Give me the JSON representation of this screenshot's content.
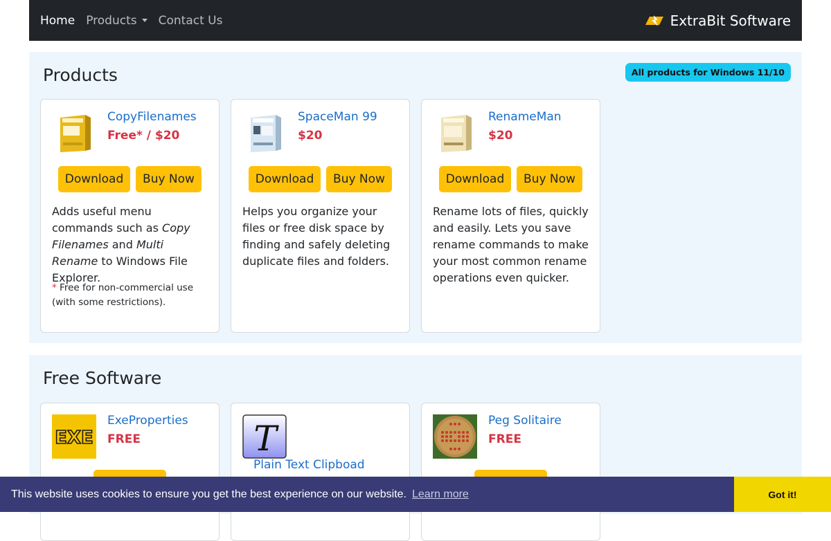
{
  "nav": {
    "home": "Home",
    "products": "Products",
    "contact": "Contact Us",
    "brand": "ExtraBit Software"
  },
  "products_section": {
    "title": "Products",
    "badge": "All products for Windows 11/10",
    "download_label": "Download",
    "buy_label": "Buy Now",
    "items": [
      {
        "name": "CopyFilenames",
        "price": "Free* / $20",
        "desc_1": "Adds useful menu commands such as ",
        "desc_em1": "Copy Filenames",
        "desc_2": " and ",
        "desc_em2": "Multi Rename",
        "desc_3": " to Windows File Explorer.",
        "footnote_star": "*",
        "footnote": " Free for non-commercial use (with some restrictions)."
      },
      {
        "name": "SpaceMan 99",
        "price": "$20",
        "desc": "Helps you organize your files or free disk space by finding and safely deleting duplicate files and folders."
      },
      {
        "name": "RenameMan",
        "price": "$20",
        "desc": "Rename lots of files, quickly and easily. Lets you save rename commands to make your most common rename operations even quicker."
      }
    ]
  },
  "free_section": {
    "title": "Free Software",
    "items": [
      {
        "name": "ExeProperties",
        "price": "FREE",
        "icon_text": "EXE"
      },
      {
        "name": "Plain Text Clipboad",
        "icon_text": "T"
      },
      {
        "name": "Peg Solitaire",
        "price": "FREE"
      }
    ]
  },
  "cookie": {
    "text": "This website uses cookies to ensure you get the best experience on our website.",
    "link": "Learn more",
    "button": "Got it!"
  },
  "colors": {
    "navbar": "#212529",
    "section_bg": "#eef6fd",
    "link": "#1a6ec9",
    "price": "#d63344",
    "button": "#ffc107",
    "badge": "#17c7ef",
    "cookie_bar": "#383b75",
    "cookie_button": "#f1d600"
  }
}
